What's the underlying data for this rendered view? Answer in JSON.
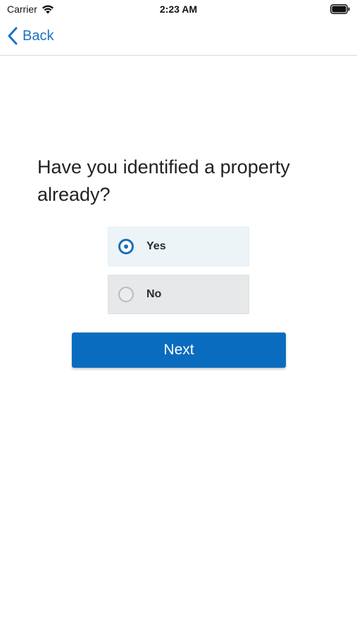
{
  "status_bar": {
    "carrier": "Carrier",
    "time": "2:23 AM",
    "icons": [
      "wifi-icon",
      "battery-icon"
    ]
  },
  "nav": {
    "back_label": "Back",
    "back_icon": "chevron-left-icon",
    "accent_color": "#1a73c2"
  },
  "question": {
    "text": "Have you identified a property already?"
  },
  "options": [
    {
      "label": "Yes",
      "selected": true
    },
    {
      "label": "No",
      "selected": false
    }
  ],
  "next_button": {
    "label": "Next",
    "color": "#0a6cbf"
  }
}
